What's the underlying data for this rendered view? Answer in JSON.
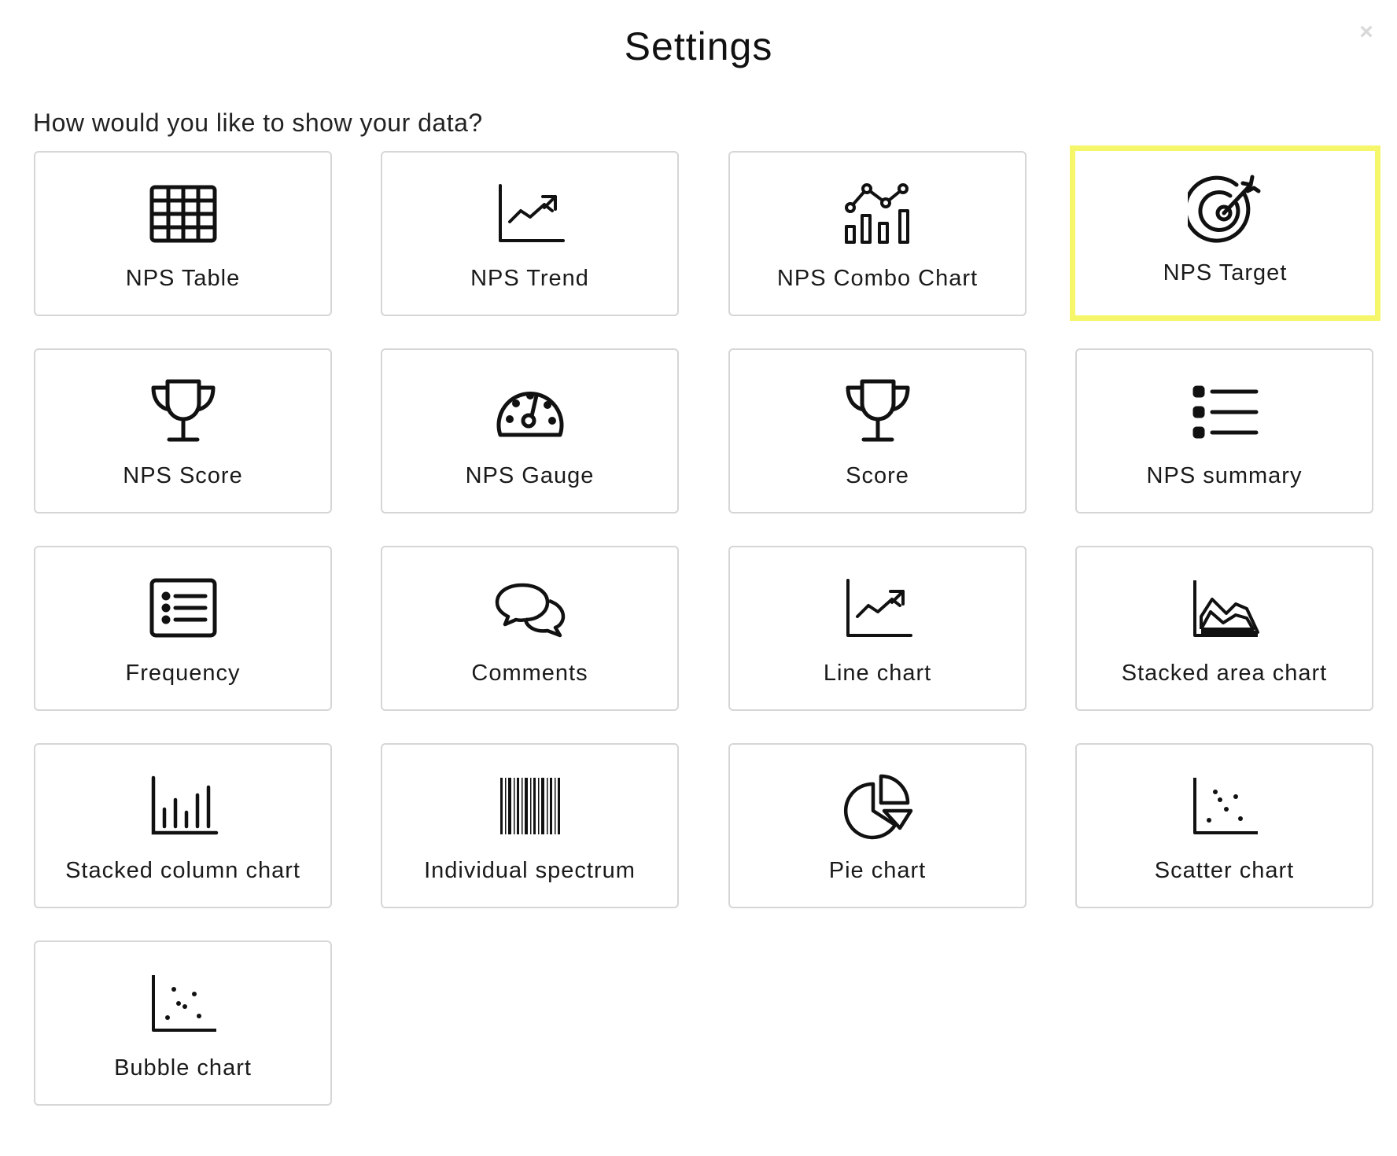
{
  "dialog": {
    "title": "Settings",
    "close_glyph": "×",
    "question": "How would you like to show your data?"
  },
  "selected_color": "#f6f66a",
  "options": [
    {
      "label": "NPS Table",
      "icon": "table-icon",
      "selected": false
    },
    {
      "label": "NPS Trend",
      "icon": "trend-icon",
      "selected": false
    },
    {
      "label": "NPS Combo Chart",
      "icon": "combo-chart-icon",
      "selected": false
    },
    {
      "label": "NPS Target",
      "icon": "target-icon",
      "selected": true
    },
    {
      "label": "NPS Score",
      "icon": "trophy-icon",
      "selected": false
    },
    {
      "label": "NPS Gauge",
      "icon": "gauge-icon",
      "selected": false
    },
    {
      "label": "Score",
      "icon": "trophy-icon",
      "selected": false
    },
    {
      "label": "NPS summary",
      "icon": "list-icon",
      "selected": false
    },
    {
      "label": "Frequency",
      "icon": "list-box-icon",
      "selected": false
    },
    {
      "label": "Comments",
      "icon": "comments-icon",
      "selected": false
    },
    {
      "label": "Line chart",
      "icon": "line-chart-icon",
      "selected": false
    },
    {
      "label": "Stacked area chart",
      "icon": "area-chart-icon",
      "selected": false
    },
    {
      "label": "Stacked column chart",
      "icon": "column-chart-icon",
      "selected": false
    },
    {
      "label": "Individual spectrum",
      "icon": "barcode-icon",
      "selected": false
    },
    {
      "label": "Pie chart",
      "icon": "pie-chart-icon",
      "selected": false
    },
    {
      "label": "Scatter chart",
      "icon": "scatter-chart-icon",
      "selected": false
    },
    {
      "label": "Bubble chart",
      "icon": "bubble-chart-icon",
      "selected": false
    }
  ]
}
